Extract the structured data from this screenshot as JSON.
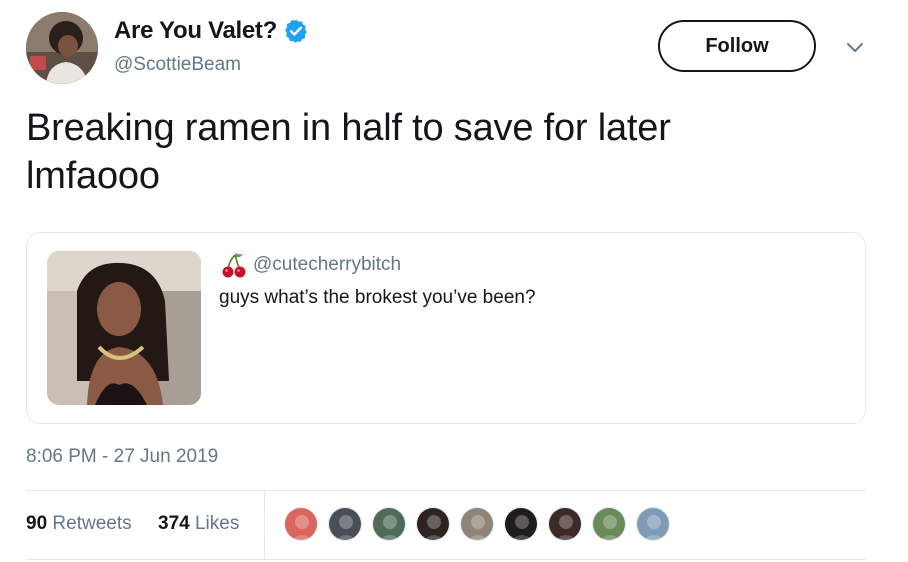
{
  "author": {
    "display_name": "Are You Valet?",
    "handle": "@ScottieBeam",
    "verified": true,
    "avatar_icon": "profile-photo"
  },
  "follow_label": "Follow",
  "caret_icon": "chevron-down-icon",
  "tweet": {
    "line1": "Breaking ramen in half to save for later",
    "line2": "lmfaooo"
  },
  "quoted_tweet": {
    "emoji": "cherry-icon",
    "handle": "@cutecherrybitch",
    "text": "guys what’s the brokest you’ve been?",
    "media": "photo"
  },
  "timestamp": "8:06 PM - 27 Jun 2019",
  "stats": {
    "retweets_count": "90",
    "retweets_label": "Retweets",
    "likes_count": "374",
    "likes_label": "Likes"
  },
  "liker_avatars": [
    {
      "color": "#d9665e"
    },
    {
      "color": "#4a4e57"
    },
    {
      "color": "#4f6b58"
    },
    {
      "color": "#2d2421"
    },
    {
      "color": "#8e8478"
    },
    {
      "color": "#1f1c1a"
    },
    {
      "color": "#3b2a25"
    },
    {
      "color": "#6a8a5a"
    },
    {
      "color": "#7f9cb6"
    }
  ],
  "colors": {
    "verified_blue": "#1da1f2",
    "secondary_text": "#657786",
    "border": "#e1e8ed"
  }
}
